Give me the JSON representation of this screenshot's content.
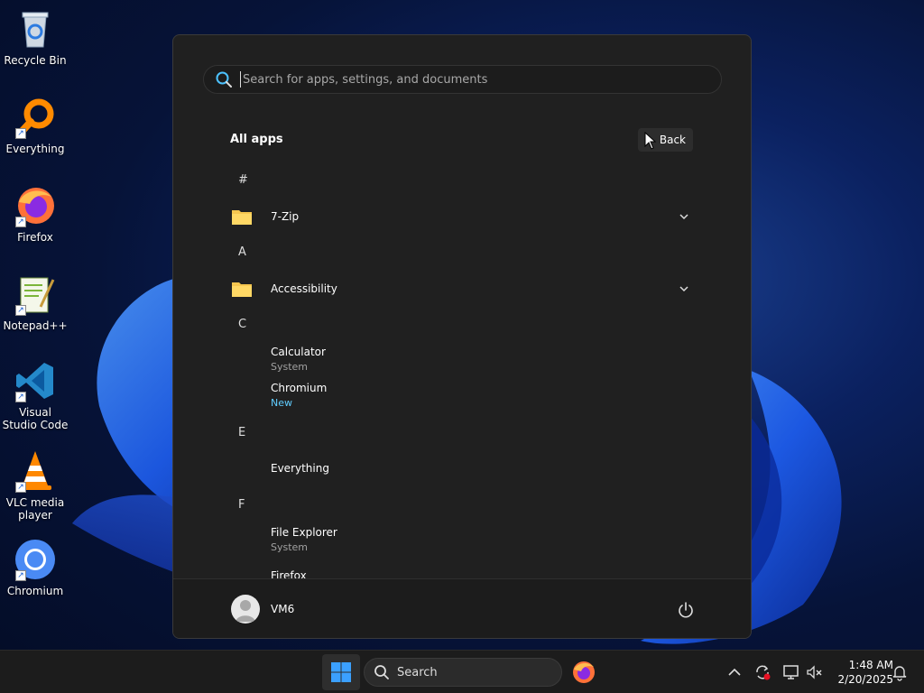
{
  "desktop": {
    "icons": [
      {
        "label": "Recycle Bin",
        "icon": "recycle-bin-icon"
      },
      {
        "label": "Everything",
        "icon": "everything-icon"
      },
      {
        "label": "Firefox",
        "icon": "firefox-icon"
      },
      {
        "label": "Notepad++",
        "icon": "notepadpp-icon"
      },
      {
        "label": "Visual Studio Code",
        "icon": "vscode-icon"
      },
      {
        "label": "VLC media player",
        "icon": "vlc-icon"
      },
      {
        "label": "Chromium",
        "icon": "chromium-icon"
      }
    ]
  },
  "start_menu": {
    "search_placeholder": "Search for apps, settings, and documents",
    "all_apps_title": "All apps",
    "back_label": "Back",
    "sections": [
      {
        "letter": "#",
        "apps": [
          {
            "name": "7-Zip",
            "type": "folder"
          }
        ]
      },
      {
        "letter": "A",
        "apps": [
          {
            "name": "Accessibility",
            "type": "folder"
          }
        ]
      },
      {
        "letter": "C",
        "apps": [
          {
            "name": "Calculator",
            "sub": "System"
          },
          {
            "name": "Chromium",
            "sub": "New"
          }
        ]
      },
      {
        "letter": "E",
        "apps": [
          {
            "name": "Everything"
          }
        ]
      },
      {
        "letter": "F",
        "apps": [
          {
            "name": "File Explorer",
            "sub": "System"
          },
          {
            "name": "Firefox"
          }
        ]
      }
    ],
    "user_name": "VM6"
  },
  "taskbar": {
    "search_label": "Search",
    "time": "1:48 AM",
    "date": "2/20/2025"
  },
  "colors": {
    "menu_bg": "#202020",
    "accent_new": "#60cdff",
    "folder": "#f6c64f"
  }
}
